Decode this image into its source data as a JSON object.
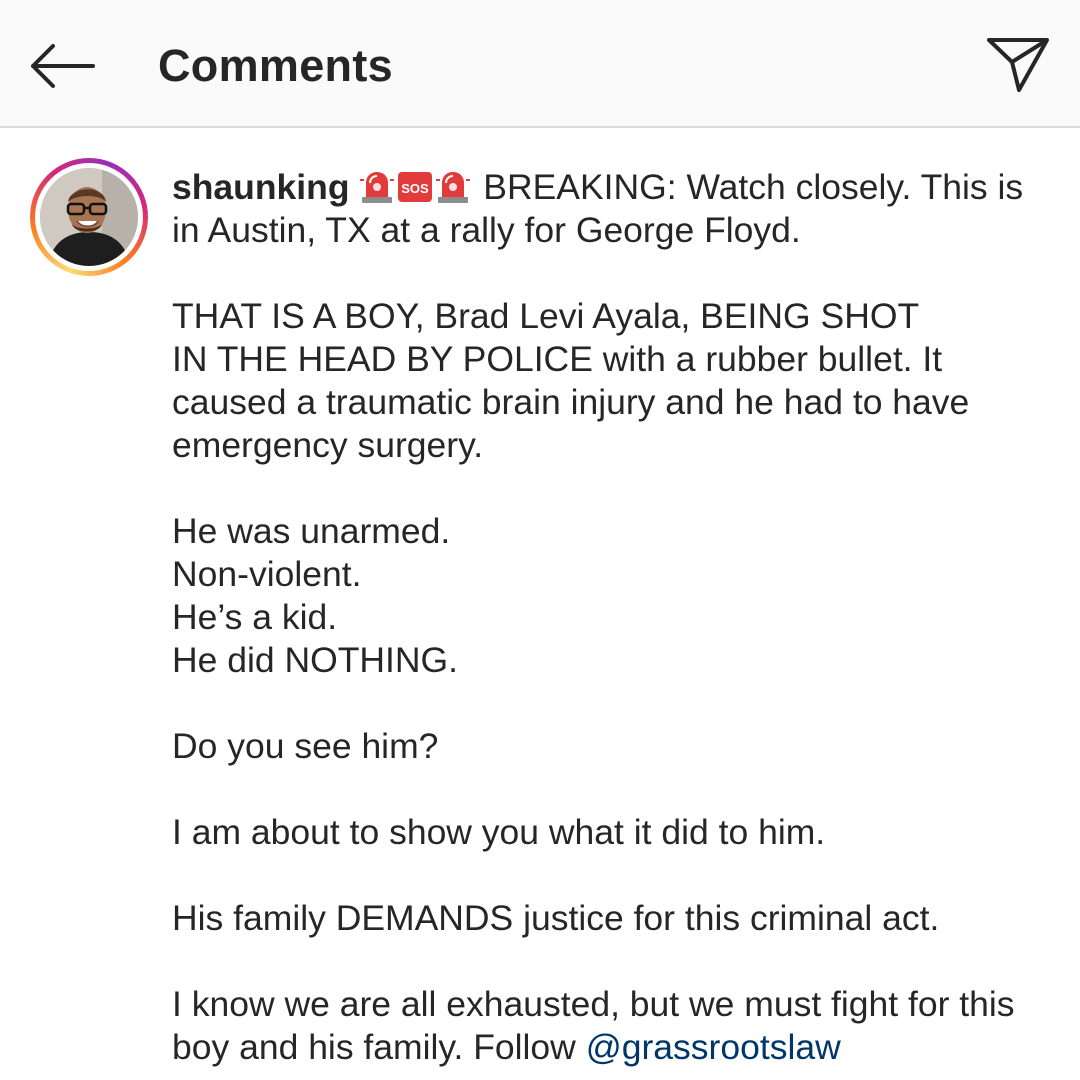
{
  "header": {
    "title": "Comments",
    "back_icon": "arrow-left-icon",
    "share_icon": "paper-plane-icon"
  },
  "comment": {
    "username": "shaunking",
    "emojis": [
      "police-light-emoji",
      "sos-emoji",
      "police-light-emoji"
    ],
    "sos_text": "SOS",
    "lines": [
      " BREAKING: Watch closely. This is in Austin, TX at a rally for George Floyd.\n\nTHAT IS A BOY, Brad Levi Ayala, BEING SHOT\nIN THE HEAD BY POLICE with a rubber bullet. It caused a traumatic brain injury and he had to have emergency surgery.\n\nHe was unarmed.\nNon-violent.\nHe’s a kid.\nHe did NOTHING.\n\nDo you see him?\n\nI am about to show you what it did to him.\n\nHis family DEMANDS justice for this criminal act.\n\nI know we are all exhausted, but we must fight for this boy and his family. Follow "
    ],
    "mention": "@grassrootslaw"
  },
  "colors": {
    "header_bg": "#fafafa",
    "text": "#262626",
    "mention": "#00376b",
    "emoji_red": "#e23b3b"
  }
}
